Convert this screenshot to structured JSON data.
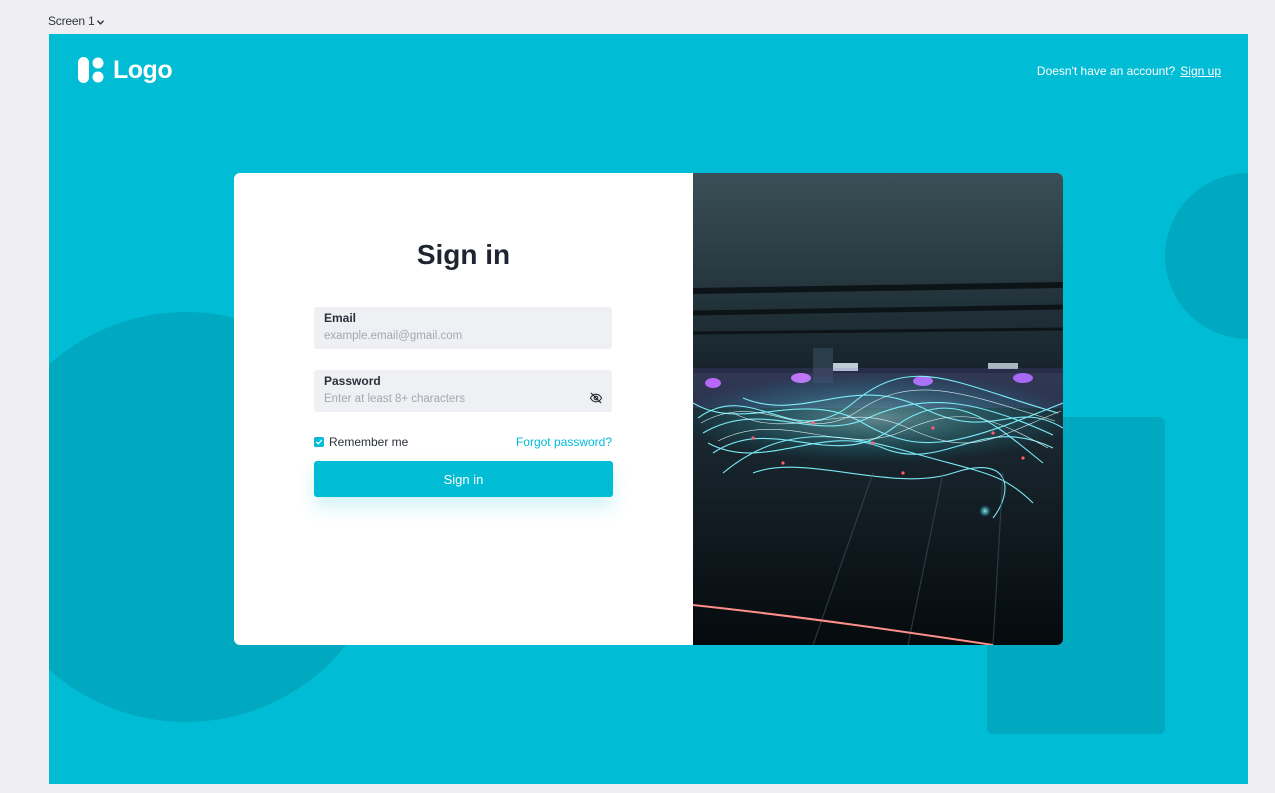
{
  "canvas": {
    "screen_label": "Screen 1"
  },
  "header": {
    "logo_text": "Logo",
    "prompt_text": "Doesn't have an account?",
    "signup_label": "Sign up"
  },
  "form": {
    "title": "Sign in",
    "email": {
      "label": "Email",
      "placeholder": "example.email@gmail.com"
    },
    "password": {
      "label": "Password",
      "placeholder": "Enter at least 8+ characters"
    },
    "remember_label": "Remember me",
    "remember_checked": true,
    "forgot_label": "Forgot password?",
    "submit_label": "Sign in"
  },
  "icons": {
    "logo": "logo-mark-icon",
    "password_toggle": "eye-off-icon",
    "checkbox": "check-icon",
    "screen_menu": "chevron-down-icon"
  },
  "colors": {
    "accent": "#00bcd4",
    "accent_dark": "#00a9bf",
    "canvas_bg": "#efeef3",
    "card_bg": "#ffffff",
    "field_bg": "#eff0f4",
    "text_dark": "#1f2430"
  }
}
